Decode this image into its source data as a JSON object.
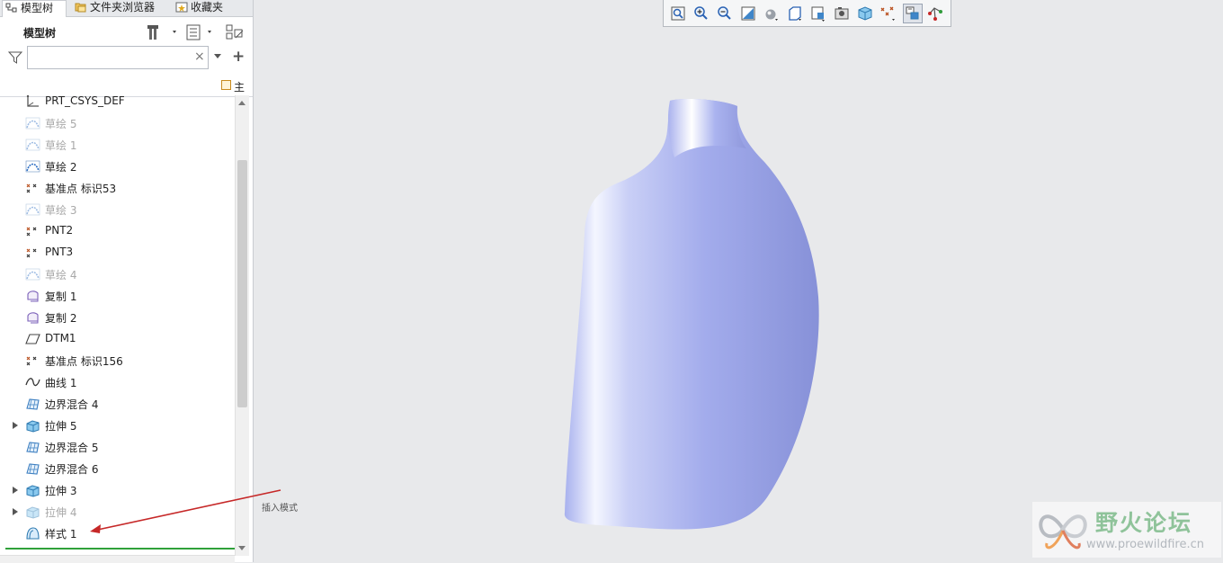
{
  "tabs": [
    {
      "label": "模型树",
      "icon": "model-tree-icon"
    },
    {
      "label": "文件夹浏览器",
      "icon": "folder-browser-icon"
    },
    {
      "label": "收藏夹",
      "icon": "favorites-icon"
    }
  ],
  "tree_panel": {
    "title": "模型树",
    "search_value": "",
    "column_header": "主"
  },
  "tree": [
    {
      "label": "PRT_CSYS_DEF",
      "icon": "csys-icon",
      "dim": false,
      "expandable": false
    },
    {
      "label": "草绘 5",
      "icon": "sketch-icon",
      "dim": true,
      "expandable": false
    },
    {
      "label": "草绘 1",
      "icon": "sketch-icon",
      "dim": true,
      "expandable": false
    },
    {
      "label": "草绘 2",
      "icon": "sketch-icon",
      "dim": false,
      "expandable": false
    },
    {
      "label": "基准点 标识53",
      "icon": "datum-point-icon",
      "dim": false,
      "expandable": false
    },
    {
      "label": "草绘 3",
      "icon": "sketch-icon",
      "dim": true,
      "expandable": false
    },
    {
      "label": "PNT2",
      "icon": "datum-point-icon",
      "dim": false,
      "expandable": false
    },
    {
      "label": "PNT3",
      "icon": "datum-point-icon",
      "dim": false,
      "expandable": false
    },
    {
      "label": "草绘 4",
      "icon": "sketch-icon",
      "dim": true,
      "expandable": false
    },
    {
      "label": "复制 1",
      "icon": "copy-surface-icon",
      "dim": false,
      "expandable": false
    },
    {
      "label": "复制 2",
      "icon": "copy-surface-icon",
      "dim": false,
      "expandable": false
    },
    {
      "label": "DTM1",
      "icon": "datum-plane-icon",
      "dim": false,
      "expandable": false
    },
    {
      "label": "基准点 标识156",
      "icon": "datum-point-icon",
      "dim": false,
      "expandable": false
    },
    {
      "label": "曲线 1",
      "icon": "curve-icon",
      "dim": false,
      "expandable": false
    },
    {
      "label": "边界混合 4",
      "icon": "boundary-blend-icon",
      "dim": false,
      "expandable": false
    },
    {
      "label": "拉伸 5",
      "icon": "extrude-icon",
      "dim": false,
      "expandable": true
    },
    {
      "label": "边界混合 5",
      "icon": "boundary-blend-icon",
      "dim": false,
      "expandable": false
    },
    {
      "label": "边界混合 6",
      "icon": "boundary-blend-icon",
      "dim": false,
      "expandable": false
    },
    {
      "label": "拉伸 3",
      "icon": "extrude-icon",
      "dim": false,
      "expandable": true
    },
    {
      "label": "拉伸 4",
      "icon": "extrude-icon",
      "dim": true,
      "expandable": true
    },
    {
      "label": "样式 1",
      "icon": "style-icon",
      "dim": false,
      "expandable": false
    }
  ],
  "toolbar": [
    "refit-icon",
    "zoom-in-icon",
    "zoom-out-icon",
    "repaint-icon",
    "display-style-icon",
    "saved-orientations-icon",
    "view-manager-icon",
    "perspective-icon",
    "spin-center-icon",
    "datum-display-icon",
    "annotation-display-icon",
    "model-display-icon"
  ],
  "annotation": {
    "text": "插入模式"
  },
  "watermark": {
    "title": "野火论坛",
    "url": "www.proewildfire.cn"
  },
  "colors": {
    "model_fill": "#9ea8ec",
    "model_highlight": "#f4f6ff",
    "arrow": "#c62828",
    "insert_line": "#2fa13a"
  }
}
